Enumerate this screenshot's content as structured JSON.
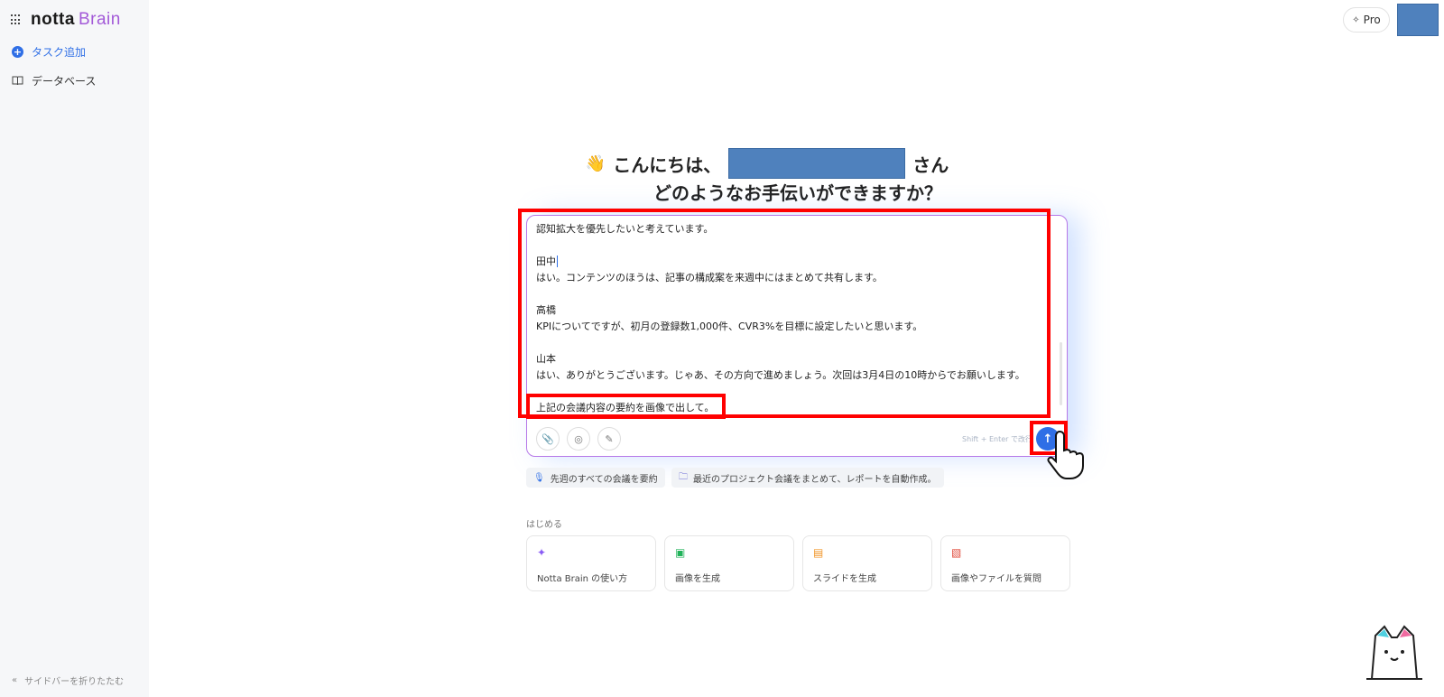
{
  "sidebar": {
    "brand_main": "notta",
    "brand_sub": "Brain",
    "add_task": "タスク追加",
    "database": "データベース",
    "collapse": "サイドバーを折りたたむ"
  },
  "header": {
    "pro_label": "Pro"
  },
  "greeting": {
    "hello": "こんにちは、",
    "suffix": "さん",
    "question": "どのようなお手伝いができますか？"
  },
  "chat": {
    "lines": [
      "認知拡大を優先したいと考えています。",
      "",
      "田中",
      "はい。コンテンツのほうは、記事の構成案を来週中にはまとめて共有します。",
      "",
      "高橋",
      "KPIについてですが、初月の登録数1,000件、CVR3%を目標に設定したいと思います。",
      "",
      "山本",
      "はい、ありがとうございます。じゃあ、その方向で進めましょう。次回は3月4日の10時からでお願いします。",
      "",
      "上記の会議内容の要約を画像で出して。"
    ],
    "hint": "Shift + Enter で改行"
  },
  "suggestions": [
    "先週のすべての会議を要約",
    "最近のプロジェクト会議をまとめて、レポートを自動作成。"
  ],
  "start_label": "はじめる",
  "cards": [
    "Notta Brain の使い方",
    "画像を生成",
    "スライドを生成",
    "画像やファイルを質問"
  ]
}
